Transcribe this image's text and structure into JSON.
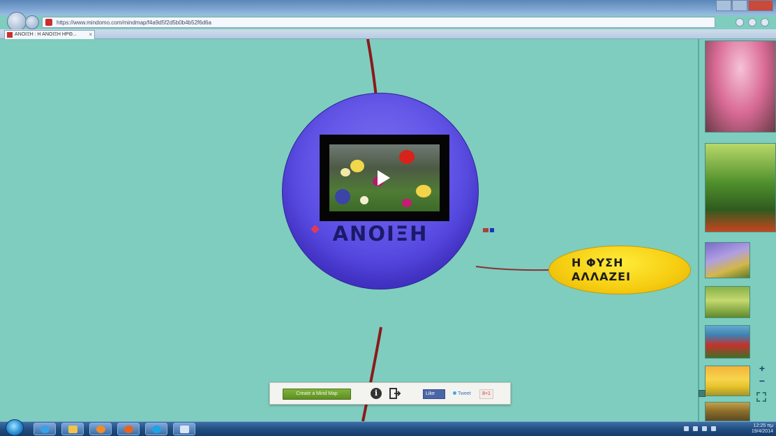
{
  "browser": {
    "url": "https://www.mindomo.com/mindmap/f4a9d5f2d5b0b4b52f6d6a",
    "tab_title": "ΑΝΟΙΞΗ : Η ΑΝΟΙΞΗ ΗΡΘ...",
    "tab_close": "×"
  },
  "mindmap": {
    "central_topic": "ΑΝΟΙΞΗ",
    "subtopic_line1": "Η ΦΥΣΗ",
    "subtopic_line2": "ΑΛΛΑΖΕΙ"
  },
  "toolbar": {
    "create_label": "Create a Mind Map",
    "info_label": "i",
    "facebook_label": "Like",
    "twitter_label": "Tweet",
    "gplus_label": "8+1"
  },
  "zoom": {
    "plus": "+",
    "minus": "−"
  },
  "system_tray": {
    "time": "12:25 πμ",
    "date": "19/4/2014"
  },
  "colors": {
    "canvas": "#7ecdbf",
    "central_node": "#5a4de3",
    "subtopic_node": "#f5cc10",
    "branch": "#8b1a1a"
  }
}
